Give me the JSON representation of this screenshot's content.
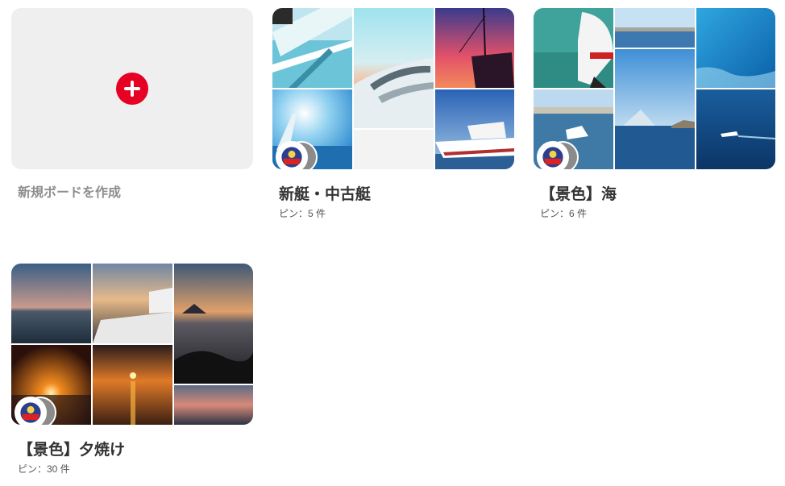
{
  "create_board": {
    "label": "新規ボードを作成"
  },
  "boards": [
    {
      "title": "新艇・中古艇",
      "pins": "ピン：5 件",
      "collaborators": "2",
      "image_names": [
        "boat-deck-photo",
        "boat-bow-sunset-photo",
        "sailboat-sunset-photo",
        "yacht-sky-photo",
        "white-yacht-photo"
      ]
    },
    {
      "title": "【景色】海",
      "pins": "ピン：6 件",
      "collaborators": "2",
      "image_names": [
        "outboard-engine-photo",
        "breakwater-photo",
        "blue-sea-waves-photo",
        "harbor-boat-photo",
        "mount-fuji-sea-photo",
        "speedboat-sea-photo"
      ]
    },
    {
      "title": "【景色】夕焼け",
      "pins": "ピン：30 件",
      "collaborators": "2",
      "image_names": [
        "dusk-sea-photo",
        "yacht-deck-dusk-photo",
        "fuji-sunset-silhouette-photo",
        "sunset-horizon-photo",
        "orange-sunset-photo",
        "rocky-shore-photo",
        "evening-clouds-photo"
      ]
    }
  ],
  "colors": {
    "accent": "#e60023",
    "create_bg": "#efefef",
    "muted_text": "#8e8e8e"
  }
}
